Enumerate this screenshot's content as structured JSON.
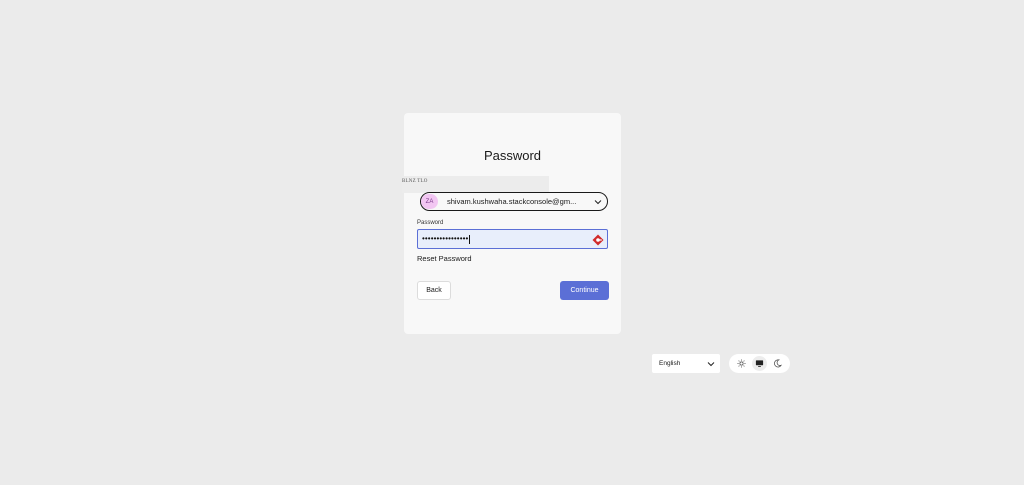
{
  "card": {
    "title": "Password",
    "overlay_text": "BLNZ TLO"
  },
  "account": {
    "avatar_initials": "ZA",
    "email": "shivam.kushwaha.stackconsole@gm..."
  },
  "password": {
    "label": "Password",
    "value_masked": "••••••••••••••••"
  },
  "links": {
    "reset_password": "Reset Password"
  },
  "buttons": {
    "back": "Back",
    "continue": "Continue"
  },
  "language": {
    "selected": "English"
  },
  "theme": {
    "options": [
      "light",
      "system",
      "dark"
    ],
    "selected": "system"
  },
  "colors": {
    "accent": "#5b6fd6",
    "background": "#ebebeb",
    "card": "#f8f8f8",
    "avatar_bg": "#f2c6f2",
    "password_manager_icon": "#d12b2b"
  },
  "icons": {
    "account_chevron": "chevron-down-icon",
    "password_manager": "password-manager-icon",
    "language_chevron": "chevron-down-icon",
    "theme_light": "sun-icon",
    "theme_system": "monitor-icon",
    "theme_dark": "moon-icon"
  }
}
